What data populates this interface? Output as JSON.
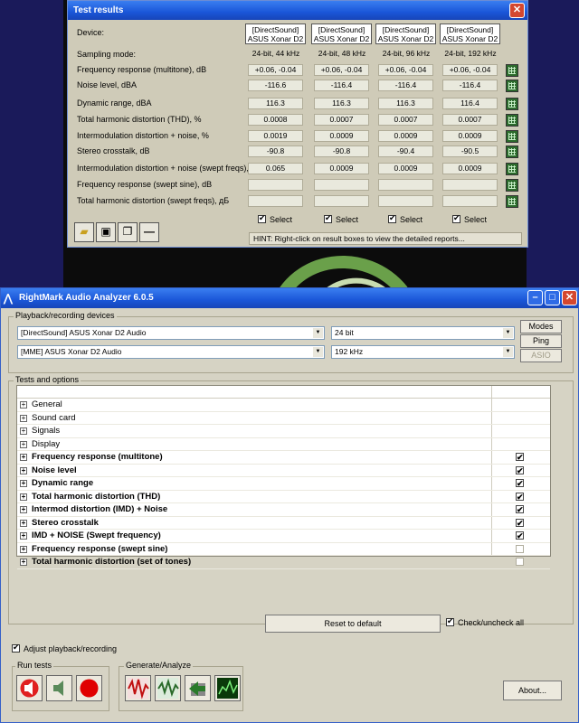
{
  "test_results": {
    "title": "Test results",
    "close": "✕",
    "device_label": "Device:",
    "devices": [
      {
        "line1": "[DirectSound]",
        "line2": "ASUS Xonar D2"
      },
      {
        "line1": "[DirectSound]",
        "line2": "ASUS Xonar D2"
      },
      {
        "line1": "[DirectSound]",
        "line2": "ASUS Xonar D2"
      },
      {
        "line1": "[DirectSound]",
        "line2": "ASUS Xonar D2"
      }
    ],
    "sampling_label": "Sampling mode:",
    "sampling": [
      "24-bit, 44 kHz",
      "24-bit, 48 kHz",
      "24-bit, 96 kHz",
      "24-bit, 192 kHz"
    ],
    "rows": [
      {
        "label": "Frequency response (multitone), dB",
        "values": [
          "+0.06, -0.04",
          "+0.06, -0.04",
          "+0.06, -0.04",
          "+0.06, -0.04"
        ]
      },
      {
        "label": "Noise level, dBA",
        "values": [
          "-116.6",
          "-116.4",
          "-116.4",
          "-116.4"
        ]
      },
      {
        "label": "Dynamic range, dBA",
        "values": [
          "116.3",
          "116.3",
          "116.3",
          "116.4"
        ]
      },
      {
        "label": "Total harmonic distortion (THD), %",
        "values": [
          "0.0008",
          "0.0007",
          "0.0007",
          "0.0007"
        ]
      },
      {
        "label": "Intermodulation distortion + noise, %",
        "values": [
          "0.0019",
          "0.0009",
          "0.0009",
          "0.0009"
        ]
      },
      {
        "label": "Stereo crosstalk, dB",
        "values": [
          "-90.8",
          "-90.8",
          "-90.4",
          "-90.5"
        ]
      },
      {
        "label": "Intermodulation distortion + noise (swept freqs), %",
        "values": [
          "0.065",
          "0.0009",
          "0.0009",
          "0.0009"
        ]
      },
      {
        "label": "Frequency response (swept sine), dB",
        "values": [
          "",
          "",
          "",
          ""
        ]
      },
      {
        "label": "Total harmonic distortion (swept freqs), дБ",
        "values": [
          "",
          "",
          "",
          ""
        ]
      }
    ],
    "select_label": "Select",
    "hint": "HINT: Right-click on result boxes to view the detailed reports..."
  },
  "analyzer": {
    "title": "RightMark Audio Analyzer 6.0.5",
    "playback_group": "Playback/recording devices",
    "playback_device": "[DirectSound] ASUS Xonar D2 Audio",
    "bit_depth": "24 bit",
    "recording_device": "[MME] ASUS Xonar D2 Audio",
    "sample_rate": "192 kHz",
    "modes": "Modes",
    "ping": "Ping",
    "asio": "ASIO",
    "tests_group": "Tests and options",
    "tree": [
      {
        "label": "General",
        "bold": false,
        "check": null
      },
      {
        "label": "Sound card",
        "bold": false,
        "check": null
      },
      {
        "label": "Signals",
        "bold": false,
        "check": null
      },
      {
        "label": "Display",
        "bold": false,
        "check": null
      },
      {
        "label": "Frequency response (multitone)",
        "bold": true,
        "check": true
      },
      {
        "label": "Noise level",
        "bold": true,
        "check": true
      },
      {
        "label": "Dynamic range",
        "bold": true,
        "check": true
      },
      {
        "label": "Total harmonic distortion (THD)",
        "bold": true,
        "check": true
      },
      {
        "label": "Intermod distortion (IMD) + Noise",
        "bold": true,
        "check": true
      },
      {
        "label": "Stereo crosstalk",
        "bold": true,
        "check": true
      },
      {
        "label": "IMD + NOISE (Swept frequency)",
        "bold": true,
        "check": true
      },
      {
        "label": "Frequency response (swept sine)",
        "bold": true,
        "check": false
      },
      {
        "label": "Total harmonic distortion (set of tones)",
        "bold": true,
        "check": false
      }
    ],
    "reset": "Reset to default",
    "check_all": "Check/uncheck all",
    "adjust": "Adjust playback/recording",
    "run_tests": "Run tests",
    "generate": "Generate/Analyze",
    "about": "About..."
  }
}
